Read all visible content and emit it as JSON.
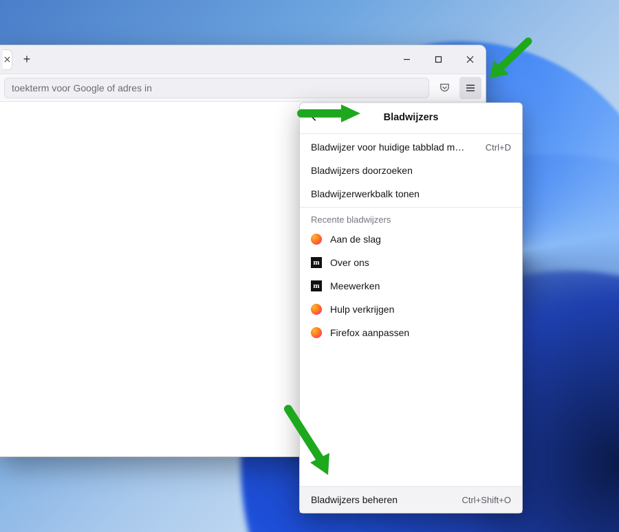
{
  "urlbar": {
    "placeholder": "toekterm voor Google of adres in"
  },
  "menu": {
    "title": "Bladwijzers",
    "actions": {
      "bookmark_current": {
        "label": "Bladwijzer voor huidige tabblad m…",
        "shortcut": "Ctrl+D"
      },
      "search": {
        "label": "Bladwijzers doorzoeken"
      },
      "show_toolbar": {
        "label": "Bladwijzerwerkbalk tonen"
      }
    },
    "recent_heading": "Recente bladwijzers",
    "recent": [
      {
        "icon": "ff",
        "label": "Aan de slag"
      },
      {
        "icon": "moz",
        "label": "Over ons"
      },
      {
        "icon": "moz",
        "label": "Meewerken"
      },
      {
        "icon": "ff",
        "label": "Hulp verkrijgen"
      },
      {
        "icon": "ff",
        "label": "Firefox aanpassen"
      }
    ],
    "manage": {
      "label": "Bladwijzers beheren",
      "shortcut": "Ctrl+Shift+O"
    }
  }
}
